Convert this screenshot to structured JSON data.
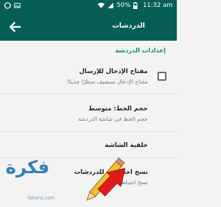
{
  "status": {
    "battery": "50%",
    "time": "11:32 am"
  },
  "appbar": {
    "title": "الدردشات"
  },
  "section": {
    "header": "إعدادات الدردشة"
  },
  "rows": [
    {
      "title": "مفتاح الإدخال للإرسال",
      "subtitle": "مفتاح الإدخال سيضيف سطرًا جديدًا",
      "checked": false
    },
    {
      "title": "حجم الخط: متوسط",
      "subtitle": "حجم الخط في شاشة الدردشة"
    },
    {
      "title": "خلفية الشاشة"
    },
    {
      "title": "نسخ احتياطي للدردشات",
      "subtitle": "نسخ احتياطي"
    }
  ],
  "watermark": {
    "main": "فكرة",
    "sub": "fokora.com"
  },
  "colors": {
    "primary": "#075e54",
    "accent": "#0a8f7b",
    "watermark": "#0b67a8",
    "arrow": "#e21b1b"
  }
}
